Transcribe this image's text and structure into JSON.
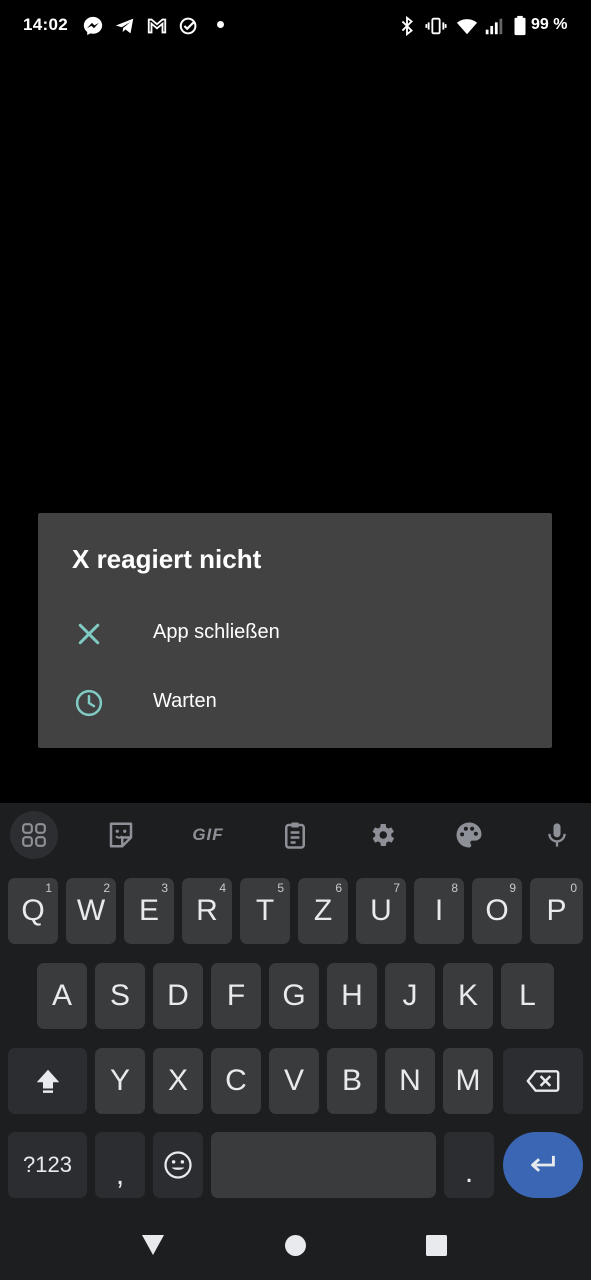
{
  "status_bar": {
    "time": "14:02",
    "battery": "99 %",
    "left_icons": [
      "messenger-icon",
      "telegram-icon",
      "gmail-icon",
      "tasks-check-icon",
      "dot-icon"
    ],
    "right_icons": [
      "bluetooth-icon",
      "vibrate-icon",
      "wifi-icon",
      "signal-icon",
      "battery-icon"
    ]
  },
  "dialog": {
    "title": "X reagiert nicht",
    "options": [
      {
        "label": "App schließen",
        "icon": "close-icon"
      },
      {
        "label": "Warten",
        "icon": "clock-icon"
      }
    ],
    "accent_color": "#80cbc4"
  },
  "keyboard": {
    "toolbar": [
      "apps-grid-icon",
      "sticker-icon",
      "GIF",
      "clipboard-icon",
      "settings-gear-icon",
      "palette-icon",
      "microphone-icon"
    ],
    "gif_label": "GIF",
    "row1": [
      {
        "k": "Q",
        "h": "1"
      },
      {
        "k": "W",
        "h": "2"
      },
      {
        "k": "E",
        "h": "3"
      },
      {
        "k": "R",
        "h": "4"
      },
      {
        "k": "T",
        "h": "5"
      },
      {
        "k": "Z",
        "h": "6"
      },
      {
        "k": "U",
        "h": "7"
      },
      {
        "k": "I",
        "h": "8"
      },
      {
        "k": "O",
        "h": "9"
      },
      {
        "k": "P",
        "h": "0"
      }
    ],
    "row2": [
      "A",
      "S",
      "D",
      "F",
      "G",
      "H",
      "J",
      "K",
      "L"
    ],
    "row3": [
      "Y",
      "X",
      "C",
      "V",
      "B",
      "N",
      "M"
    ],
    "symbols_label": "?123",
    "comma": ",",
    "period": ".",
    "enter_color": "#3a66b3"
  },
  "navbar": [
    "back-icon",
    "home-icon",
    "recents-icon"
  ]
}
